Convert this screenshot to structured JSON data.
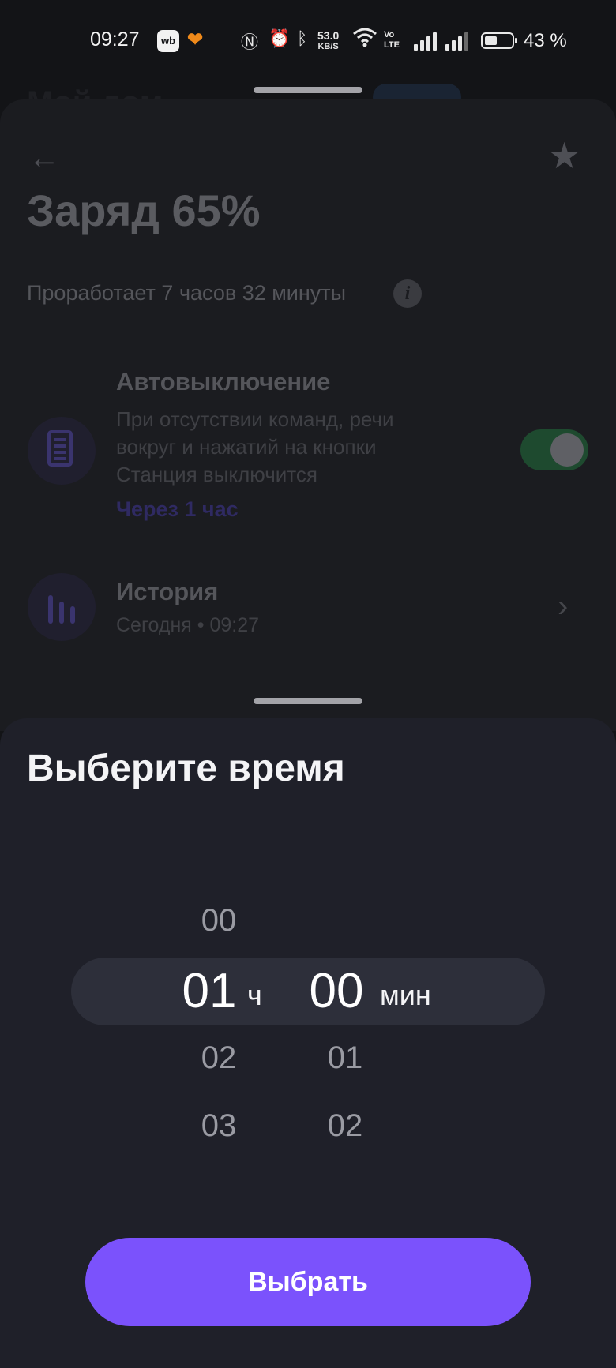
{
  "status_bar": {
    "time": "09:27",
    "wb_label": "wb",
    "net_speed_value": "53.0",
    "net_speed_unit": "KB/S",
    "volte_label": "Vo LTE",
    "battery_percent": "43 %",
    "battery_level": 0.43
  },
  "background": {
    "page_title": "Мой дом",
    "charge_title": "Заряд 65%",
    "works_text": "Проработает 7 часов 32 минуты",
    "info_glyph": "i",
    "auto_off": {
      "title": "Автовыключение",
      "description": "При отсутствии команд, речи вокруг и нажатий на кнопки Станция выключится",
      "link": "Через 1 час",
      "enabled": true
    },
    "history": {
      "title": "История",
      "subtitle": "Сегодня • 09:27"
    }
  },
  "picker": {
    "title": "Выберите время",
    "hours_above": "00",
    "hours_selected": "01",
    "hours_unit": "ч",
    "hours_below_1": "02",
    "hours_below_2": "03",
    "minutes_selected": "00",
    "minutes_unit": "мин",
    "minutes_below_1": "01",
    "minutes_below_2": "02",
    "confirm_label": "Выбрать"
  },
  "colors": {
    "accent": "#7b52fc",
    "sheet_bg": "#1f2029",
    "toggle_on": "#1e4a2f"
  }
}
